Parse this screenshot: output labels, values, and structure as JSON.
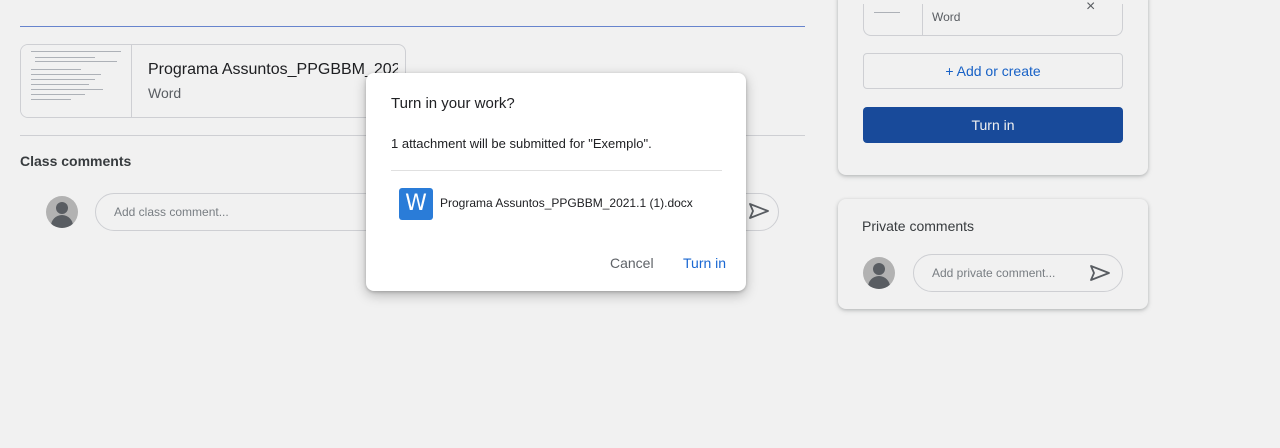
{
  "attachment": {
    "title": "Programa Assuntos_PPGBBM_2021.1 (1)",
    "type": "Word"
  },
  "class_comments": {
    "title": "Class comments",
    "placeholder": "Add class comment..."
  },
  "your_work": {
    "attached_file_type": "Word",
    "remove_symbol": "×",
    "add_or_create_label": "+ Add or create",
    "turn_in_label": "Turn in"
  },
  "private_comments": {
    "title": "Private comments",
    "placeholder": "Add private comment..."
  },
  "dialog": {
    "title": "Turn in your work?",
    "message": "1 attachment will be submitted for \"Exemplo\".",
    "file_icon_letter": "W",
    "file_name": "Programa Assuntos_PPGBBM_2021.1 (1).docx",
    "cancel_label": "Cancel",
    "confirm_label": "Turn in"
  },
  "colors": {
    "accent": "#1967d2",
    "primary_button": "#1a4fa3",
    "word_icon": "#2a7cd8"
  }
}
